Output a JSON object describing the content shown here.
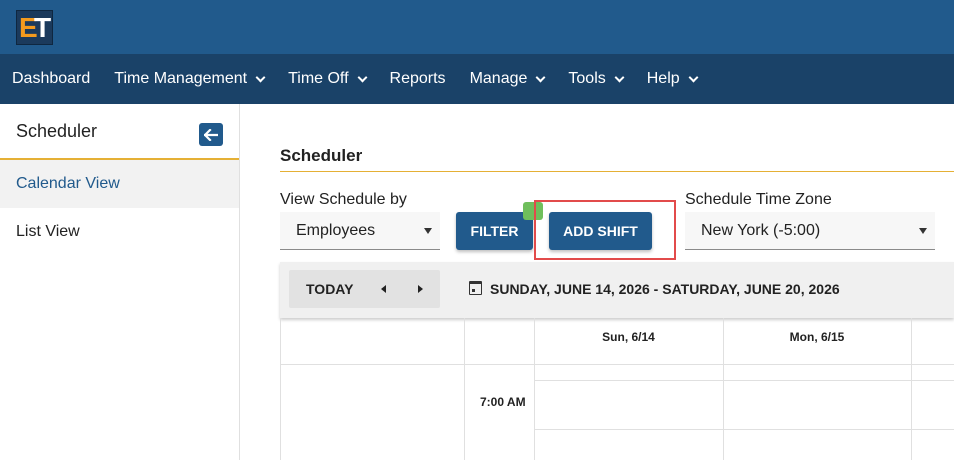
{
  "app": {
    "logo_e": "E",
    "logo_t": "T"
  },
  "nav": {
    "items": [
      {
        "label": "Dashboard",
        "dropdown": false
      },
      {
        "label": "Time Management",
        "dropdown": true
      },
      {
        "label": "Time Off",
        "dropdown": true
      },
      {
        "label": "Reports",
        "dropdown": false
      },
      {
        "label": "Manage",
        "dropdown": true
      },
      {
        "label": "Tools",
        "dropdown": true
      },
      {
        "label": "Help",
        "dropdown": true
      }
    ]
  },
  "sidebar": {
    "title": "Scheduler",
    "items": [
      {
        "label": "Calendar View",
        "active": true
      },
      {
        "label": "List View",
        "active": false
      }
    ]
  },
  "main": {
    "title": "Scheduler",
    "view_by_label": "View Schedule by",
    "view_by_value": "Employees",
    "filter_label": "FILTER",
    "add_shift_label": "ADD SHIFT",
    "timezone_label": "Schedule Time Zone",
    "timezone_value": "New York (-5:00)"
  },
  "calendar": {
    "today_label": "TODAY",
    "date_range": "SUNDAY, JUNE 14, 2026 - SATURDAY, JUNE 20, 2026",
    "days": [
      "Sun, 6/14",
      "Mon, 6/15"
    ],
    "times": [
      "7:00 AM"
    ]
  },
  "colors": {
    "brand": "#215a8c",
    "nav_bg": "#1a4268",
    "accent_line": "#e5b035",
    "highlight": "#e24b4b",
    "badge": "#6fbf5c"
  }
}
